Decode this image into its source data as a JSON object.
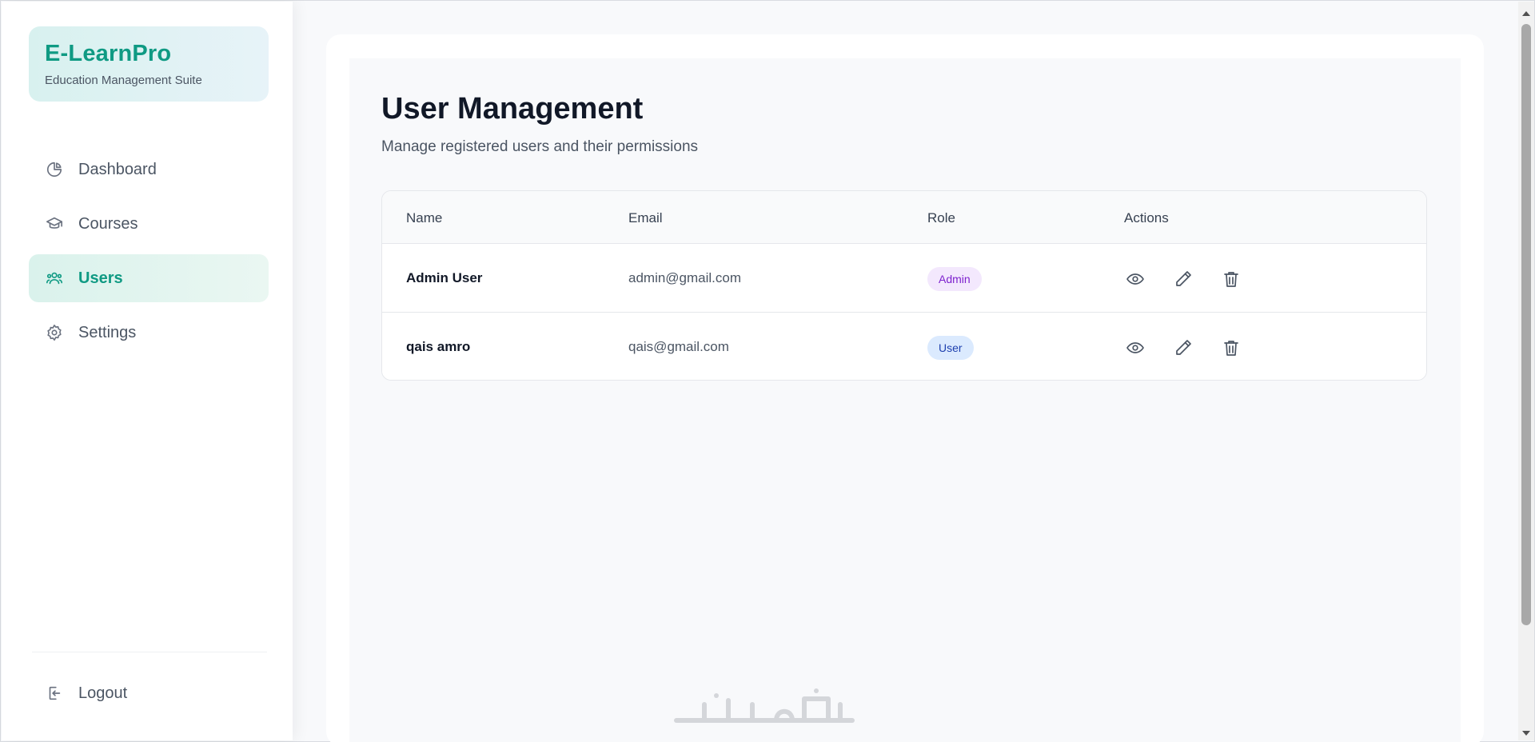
{
  "brand": {
    "title": "E-LearnPro",
    "subtitle": "Education Management Suite"
  },
  "sidebar": {
    "items": [
      {
        "label": "Dashboard",
        "icon": "pie-chart-icon",
        "active": false
      },
      {
        "label": "Courses",
        "icon": "graduation-cap-icon",
        "active": false
      },
      {
        "label": "Users",
        "icon": "users-icon",
        "active": true
      },
      {
        "label": "Settings",
        "icon": "gear-icon",
        "active": false
      }
    ],
    "logout_label": "Logout"
  },
  "page": {
    "title": "User Management",
    "subtitle": "Manage registered users and their permissions"
  },
  "table": {
    "headers": {
      "name": "Name",
      "email": "Email",
      "role": "Role",
      "actions": "Actions"
    },
    "rows": [
      {
        "name": "Admin User",
        "email": "admin@gmail.com",
        "role": "Admin"
      },
      {
        "name": "qais amro",
        "email": "qais@gmail.com",
        "role": "User"
      }
    ],
    "action_icons": [
      "eye-icon",
      "pencil-icon",
      "trash-icon"
    ]
  },
  "watermark": {
    "text": "خمسات"
  },
  "colors": {
    "accent": "#0f9a83",
    "admin_badge_bg": "#f3e8fd",
    "admin_badge_text": "#7e22ce",
    "user_badge_bg": "#dbeafe",
    "user_badge_text": "#1e40af"
  }
}
